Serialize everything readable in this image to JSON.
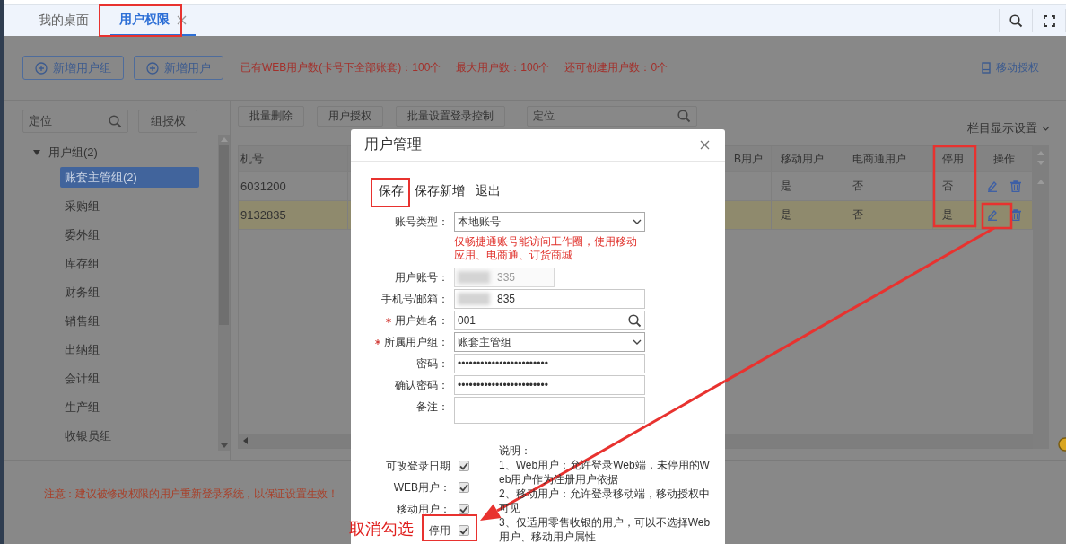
{
  "tabs": [
    {
      "label": "我的桌面",
      "selected": false,
      "closable": false
    },
    {
      "label": "用户权限",
      "selected": true,
      "closable": true
    }
  ],
  "header": {
    "buttons": [
      "新增用户组",
      "新增用户"
    ],
    "stats": [
      "已有WEB用户数(卡号下全部账套)：100个",
      "最大用户数：100个",
      "还可创建用户数：0个"
    ],
    "mobile_auth": "移动授权"
  },
  "sidebar": {
    "search_placeholder": "定位",
    "group_button": "组授权",
    "tree": [
      {
        "label": "用户组(2)",
        "expanded": true,
        "children": [
          {
            "label": "账套主管组(2)",
            "selected": true
          },
          {
            "label": "采购组",
            "selected": false
          },
          {
            "label": "委外组",
            "selected": false
          },
          {
            "label": "库存组",
            "selected": false
          },
          {
            "label": "财务组",
            "selected": false
          },
          {
            "label": "销售组",
            "selected": false
          },
          {
            "label": "出纳组",
            "selected": false
          },
          {
            "label": "会计组",
            "selected": false
          },
          {
            "label": "生产组",
            "selected": false
          },
          {
            "label": "收银员组",
            "selected": false
          }
        ]
      }
    ]
  },
  "table_toolbar": {
    "buttons": [
      "批量删除",
      "用户授权",
      "批量设置登录控制"
    ],
    "search_placeholder": "定位",
    "column_settings": "栏目显示设置"
  },
  "table": {
    "columns": [
      "机号",
      "B用户",
      "移动用户",
      "电商通用户",
      "停用",
      "操作"
    ],
    "rows": [
      {
        "number": "6031200",
        "mobile_user": "是",
        "ecommerce_user": "否",
        "disabled": "否",
        "selected": false
      },
      {
        "number": "9132835",
        "mobile_user": "是",
        "ecommerce_user": "否",
        "disabled": "是",
        "selected": true
      }
    ]
  },
  "footer_note": "注意：建议被修改权限的用户重新登录系统，以保证设置生效！",
  "dialog": {
    "title": "用户管理",
    "actions": [
      "保存",
      "保存新增",
      "退出"
    ],
    "fields": [
      {
        "label": "账号类型：",
        "kind": "select",
        "value": "本地账号",
        "required": false,
        "disabled": false,
        "hint": "仅畅捷通账号能访问工作圈，使用移动应用、电商通、订货商城"
      },
      {
        "label": "用户账号：",
        "kind": "masked",
        "value": "335",
        "required": false,
        "disabled": true
      },
      {
        "label": "手机号/邮箱：",
        "kind": "masked",
        "value": "835",
        "required": false,
        "disabled": false
      },
      {
        "label": "用户姓名：",
        "kind": "lookup",
        "value": "001",
        "required": true,
        "disabled": false
      },
      {
        "label": "所属用户组：",
        "kind": "select",
        "value": "账套主管组",
        "required": true,
        "disabled": false
      },
      {
        "label": "密码：",
        "kind": "text",
        "value": "••••••••••••••••••••••••",
        "required": false,
        "disabled": false
      },
      {
        "label": "确认密码：",
        "kind": "text",
        "value": "••••••••••••••••••••••••",
        "required": false,
        "disabled": false
      },
      {
        "label": "备注：",
        "kind": "textarea",
        "required": false,
        "disabled": false
      }
    ],
    "checks": [
      {
        "label": "可改登录日期",
        "checked": true
      },
      {
        "label": "WEB用户：",
        "checked": true
      },
      {
        "label": "移动用户：",
        "checked": true
      },
      {
        "label": "停用",
        "checked": true
      }
    ],
    "notes": [
      "说明：",
      "1、Web用户：允许登录Web端，未停用的Web用户作为注册用户依据",
      "2、移动用户：允许登录移动端，移动授权中可见",
      "3、仅适用零售收银的用户，可以不选择Web用户、移动用户属性"
    ]
  },
  "annotation": {
    "text": "取消勾选"
  }
}
